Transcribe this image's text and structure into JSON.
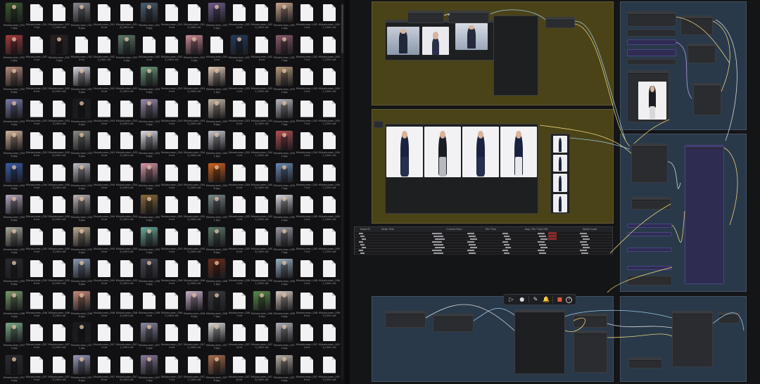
{
  "file_browser": {
    "columns": 15,
    "rows": 12,
    "files": [
      {
        "kind": "img",
        "name": "Miniakumen_0017.jpg",
        "color": "#3b5a2e"
      },
      {
        "kind": "doc",
        "name": "Miniakumen_0017.txt"
      },
      {
        "kind": "doc",
        "name": "Miniakumen_0017_0001.txt"
      },
      {
        "kind": "img",
        "name": "Miniakumen_0018.jpg",
        "color": "#8a8890"
      },
      {
        "kind": "doc",
        "name": "Miniakumen_0018.txt"
      },
      {
        "kind": "doc",
        "name": "Miniakumen_0018_0001.txt"
      },
      {
        "kind": "img",
        "name": "Miniakumen_0019.jpg",
        "color": "#4a5d6e"
      },
      {
        "kind": "doc",
        "name": "Miniakumen_0019.txt"
      },
      {
        "kind": "doc",
        "name": "Miniakumen_0019_0001.txt"
      },
      {
        "kind": "img",
        "name": "Miniakumen_0020.jpg",
        "color": "#6e5b8a"
      },
      {
        "kind": "doc",
        "name": "Miniakumen_0020.txt"
      },
      {
        "kind": "doc",
        "name": "Miniakumen_0020_0001.txt"
      },
      {
        "kind": "img",
        "name": "Miniakumen_0021.jpg",
        "color": "#c5a58c"
      },
      {
        "kind": "doc",
        "name": "Miniakumen_0021.txt"
      },
      {
        "kind": "doc",
        "name": "Miniakumen_0021_0001.txt"
      },
      {
        "kind": "img",
        "name": "Miniakumen_0022.jpg",
        "color": "#a33a3a"
      },
      {
        "kind": "doc",
        "name": "Miniakumen_0022.txt"
      },
      {
        "kind": "img",
        "name": "Miniakumen_0023.jpg",
        "color": "#2a1f1f"
      },
      {
        "kind": "doc",
        "name": "Miniakumen_0023.txt"
      },
      {
        "kind": "doc",
        "name": "Miniakumen_0023_0001.txt"
      },
      {
        "kind": "img",
        "name": "Miniakumen_0024.jpg",
        "color": "#5b7a6a"
      },
      {
        "kind": "doc",
        "name": "Miniakumen_0024.txt"
      },
      {
        "kind": "doc",
        "name": "Miniakumen_0024_0001.txt"
      },
      {
        "kind": "img",
        "name": "Miniakumen_0025.jpg",
        "color": "#c98a93"
      },
      {
        "kind": "doc",
        "name": "Miniakumen_0025.txt"
      },
      {
        "kind": "img",
        "name": "Miniakumen_0026.jpg",
        "color": "#243a5a"
      },
      {
        "kind": "doc",
        "name": "Miniakumen_0026.txt"
      },
      {
        "kind": "img",
        "name": "Miniakumen_0027.jpg",
        "color": "#8a5a6a"
      },
      {
        "kind": "doc",
        "name": "Miniakumen_0027.txt"
      },
      {
        "kind": "doc",
        "name": "Miniakumen_0027_0001.txt"
      },
      {
        "kind": "img",
        "name": "Miniakumen_0028.jpg",
        "color": "#b58a7a"
      },
      {
        "kind": "doc",
        "name": "Miniakumen_0028.txt"
      },
      {
        "kind": "doc",
        "name": "Miniakumen_0028_0001.txt"
      },
      {
        "kind": "img",
        "name": "Miniakumen_0029.jpg",
        "color": "#d8d4dc"
      },
      {
        "kind": "doc",
        "name": "Miniakumen_0029.txt"
      },
      {
        "kind": "doc",
        "name": "Miniakumen_0029_0001.txt"
      },
      {
        "kind": "img",
        "name": "Miniakumen_0030.jpg",
        "color": "#6a9a7a"
      },
      {
        "kind": "doc",
        "name": "Miniakumen_0030.txt"
      },
      {
        "kind": "doc",
        "name": "Miniakumen_0030_0001.txt"
      },
      {
        "kind": "img",
        "name": "Miniakumen_0031.jpg",
        "color": "#e2c9b8"
      },
      {
        "kind": "doc",
        "name": "Miniakumen_0031.txt"
      },
      {
        "kind": "doc",
        "name": "Miniakumen_0031_0001.txt"
      },
      {
        "kind": "img",
        "name": "Miniakumen_0032.jpg",
        "color": "#b59a7a"
      },
      {
        "kind": "doc",
        "name": "Miniakumen_0032.txt"
      },
      {
        "kind": "doc",
        "name": "Miniakumen_0032_0001.txt"
      },
      {
        "kind": "img",
        "name": "Miniakumen_0033.jpg",
        "color": "#7a7aa8"
      },
      {
        "kind": "doc",
        "name": "Miniakumen_0033.txt"
      },
      {
        "kind": "doc",
        "name": "Miniakumen_0033_0001.txt"
      },
      {
        "kind": "img",
        "name": "Miniakumen_0034.jpg",
        "color": "#1a1a1a"
      },
      {
        "kind": "doc",
        "name": "Miniakumen_0034.txt"
      },
      {
        "kind": "doc",
        "name": "Miniakumen_0034_0001.txt"
      },
      {
        "kind": "img",
        "name": "Miniakumen_0035.jpg",
        "color": "#9a8aa8"
      },
      {
        "kind": "doc",
        "name": "Miniakumen_0035.txt"
      },
      {
        "kind": "doc",
        "name": "Miniakumen_0035_0001.txt"
      },
      {
        "kind": "img",
        "name": "Miniakumen_0036.jpg",
        "color": "#c8b8a8"
      },
      {
        "kind": "doc",
        "name": "Miniakumen_0036.txt"
      },
      {
        "kind": "doc",
        "name": "Miniakumen_0036_0001.txt"
      },
      {
        "kind": "img",
        "name": "Miniakumen_0037.jpg",
        "color": "#b8b8c0"
      },
      {
        "kind": "doc",
        "name": "Miniakumen_0037.txt"
      },
      {
        "kind": "doc",
        "name": "Miniakumen_0037_0001.txt"
      },
      {
        "kind": "img",
        "name": "Miniakumen_0038.jpg",
        "color": "#d2b49a"
      },
      {
        "kind": "doc",
        "name": "Miniakumen_0038.txt"
      },
      {
        "kind": "doc",
        "name": "Miniakumen_0038_0001.txt"
      },
      {
        "kind": "img",
        "name": "Miniakumen_0039.jpg",
        "color": "#8a8a82"
      },
      {
        "kind": "doc",
        "name": "Miniakumen_0039.txt"
      },
      {
        "kind": "doc",
        "name": "Miniakumen_0039_0001.txt"
      },
      {
        "kind": "img",
        "name": "Miniakumen_0040.jpg",
        "color": "#e0dde6"
      },
      {
        "kind": "doc",
        "name": "Miniakumen_0040.txt"
      },
      {
        "kind": "doc",
        "name": "Miniakumen_0040_0001.txt"
      },
      {
        "kind": "img",
        "name": "Miniakumen_0041.jpg",
        "color": "#c8c8d2"
      },
      {
        "kind": "doc",
        "name": "Miniakumen_0041.txt"
      },
      {
        "kind": "doc",
        "name": "Miniakumen_0041_0001.txt"
      },
      {
        "kind": "img",
        "name": "Miniakumen_0042.jpg",
        "color": "#b05050"
      },
      {
        "kind": "doc",
        "name": "Miniakumen_0042.txt"
      },
      {
        "kind": "doc",
        "name": "Miniakumen_0042_0001.txt"
      },
      {
        "kind": "img",
        "name": "Miniakumen_0043.jpg",
        "color": "#3a5aa8"
      },
      {
        "kind": "doc",
        "name": "Miniakumen_0043.txt"
      },
      {
        "kind": "doc",
        "name": "Miniakumen_0043_0001.txt"
      },
      {
        "kind": "img",
        "name": "Miniakumen_0044.jpg",
        "color": "#c0bcc6"
      },
      {
        "kind": "doc",
        "name": "Miniakumen_0044.txt"
      },
      {
        "kind": "doc",
        "name": "Miniakumen_0044_0001.txt"
      },
      {
        "kind": "img",
        "name": "Miniakumen_0045.jpg",
        "color": "#d898a8"
      },
      {
        "kind": "doc",
        "name": "Miniakumen_0045.txt"
      },
      {
        "kind": "doc",
        "name": "Miniakumen_0045_0001.txt"
      },
      {
        "kind": "img",
        "name": "Miniakumen_0046.jpg",
        "color": "#d0601a"
      },
      {
        "kind": "doc",
        "name": "Miniakumen_0046.txt"
      },
      {
        "kind": "doc",
        "name": "Miniakumen_0046_0001.txt"
      },
      {
        "kind": "img",
        "name": "Miniakumen_0047.jpg",
        "color": "#6a8ab0"
      },
      {
        "kind": "doc",
        "name": "Miniakumen_0047.txt"
      },
      {
        "kind": "doc",
        "name": "Miniakumen_0047_0001.txt"
      },
      {
        "kind": "img",
        "name": "Miniakumen_0048.jpg",
        "color": "#b4a8c0"
      },
      {
        "kind": "doc",
        "name": "Miniakumen_0048.txt"
      },
      {
        "kind": "doc",
        "name": "Miniakumen_0048_0001.txt"
      },
      {
        "kind": "img",
        "name": "Miniakumen_0049.jpg",
        "color": "#c0b4b4"
      },
      {
        "kind": "doc",
        "name": "Miniakumen_0049.txt"
      },
      {
        "kind": "doc",
        "name": "Miniakumen_0049_0001.txt"
      },
      {
        "kind": "img",
        "name": "Miniakumen_0050.jpg",
        "color": "#8a6a3a"
      },
      {
        "kind": "doc",
        "name": "Miniakumen_0050.txt"
      },
      {
        "kind": "doc",
        "name": "Miniakumen_0050_0001.txt"
      },
      {
        "kind": "img",
        "name": "Miniakumen_0051.jpg",
        "color": "#7a8a8a"
      },
      {
        "kind": "doc",
        "name": "Miniakumen_0051.txt"
      },
      {
        "kind": "doc",
        "name": "Miniakumen_0051_0001.txt"
      },
      {
        "kind": "img",
        "name": "Miniakumen_0052.jpg",
        "color": "#d8d8e0"
      },
      {
        "kind": "doc",
        "name": "Miniakumen_0052.txt"
      },
      {
        "kind": "doc",
        "name": "Miniakumen_0052_0001.txt"
      },
      {
        "kind": "img",
        "name": "Miniakumen_0053.jpg",
        "color": "#a8a89a"
      },
      {
        "kind": "doc",
        "name": "Miniakumen_0053.txt"
      },
      {
        "kind": "doc",
        "name": "Miniakumen_0053_0001.txt"
      },
      {
        "kind": "img",
        "name": "Miniakumen_0054.jpg",
        "color": "#b8a890"
      },
      {
        "kind": "doc",
        "name": "Miniakumen_0054.txt"
      },
      {
        "kind": "doc",
        "name": "Miniakumen_0054_0001.txt"
      },
      {
        "kind": "img",
        "name": "Miniakumen_0055.jpg",
        "color": "#6aa89a"
      },
      {
        "kind": "doc",
        "name": "Miniakumen_0055.txt"
      },
      {
        "kind": "doc",
        "name": "Miniakumen_0055_0001.txt"
      },
      {
        "kind": "img",
        "name": "Miniakumen_0056.jpg",
        "color": "#5a7a6a"
      },
      {
        "kind": "doc",
        "name": "Miniakumen_0056.txt"
      },
      {
        "kind": "doc",
        "name": "Miniakumen_0056_0001.txt"
      },
      {
        "kind": "img",
        "name": "Miniakumen_0057.jpg",
        "color": "#9a9aa4"
      },
      {
        "kind": "doc",
        "name": "Miniakumen_0057.txt"
      },
      {
        "kind": "doc",
        "name": "Miniakumen_0057_0001.txt"
      },
      {
        "kind": "img",
        "name": "Miniakumen_0058.jpg",
        "color": "#2a2a2e"
      },
      {
        "kind": "doc",
        "name": "Miniakumen_0058.txt"
      },
      {
        "kind": "doc",
        "name": "Miniakumen_0058_0001.txt"
      },
      {
        "kind": "img",
        "name": "Miniakumen_0059.jpg",
        "color": "#8a9ab0"
      },
      {
        "kind": "doc",
        "name": "Miniakumen_0059.txt"
      },
      {
        "kind": "doc",
        "name": "Miniakumen_0059_0001.txt"
      },
      {
        "kind": "img",
        "name": "Miniakumen_0060.jpg",
        "color": "#4a4a58"
      },
      {
        "kind": "doc",
        "name": "Miniakumen_0060.txt"
      },
      {
        "kind": "doc",
        "name": "Miniakumen_0060_0001.txt"
      },
      {
        "kind": "img",
        "name": "Miniakumen_0061.jpg",
        "color": "#6a2a1a"
      },
      {
        "kind": "doc",
        "name": "Miniakumen_0061.txt"
      },
      {
        "kind": "doc",
        "name": "Miniakumen_0061_0001.txt"
      },
      {
        "kind": "img",
        "name": "Miniakumen_0062.jpg",
        "color": "#9ab0c0"
      },
      {
        "kind": "doc",
        "name": "Miniakumen_0062.txt"
      },
      {
        "kind": "doc",
        "name": "Miniakumen_0062_0001.txt"
      },
      {
        "kind": "img",
        "name": "Miniakumen_0063.jpg",
        "color": "#7a9a6a"
      },
      {
        "kind": "doc",
        "name": "Miniakumen_0063.txt"
      },
      {
        "kind": "doc",
        "name": "Miniakumen_0063_0001.txt"
      },
      {
        "kind": "img",
        "name": "Miniakumen_0064.jpg",
        "color": "#c88a7a"
      },
      {
        "kind": "doc",
        "name": "Miniakumen_0064.txt"
      },
      {
        "kind": "doc",
        "name": "Miniakumen_0064_0001.txt"
      },
      {
        "kind": "doc",
        "name": "Miniakumen_0065.txt"
      },
      {
        "kind": "doc",
        "name": "Miniakumen_0065_0001.txt"
      },
      {
        "kind": "img",
        "name": "Miniakumen_0066.jpg",
        "color": "#c8b0c8"
      },
      {
        "kind": "img",
        "name": "Miniakumen_0067.jpg",
        "color": "#3a3a3e"
      },
      {
        "kind": "doc",
        "name": "Miniakumen_0067.txt"
      },
      {
        "kind": "img",
        "name": "Miniakumen_0068.jpg",
        "color": "#5a8a4a"
      },
      {
        "kind": "img",
        "name": "Miniakumen_0069.jpg",
        "color": "#d8c8c0"
      },
      {
        "kind": "doc",
        "name": "Miniakumen_0069.txt"
      },
      {
        "kind": "doc",
        "name": "Miniakumen_0069_0001.txt"
      },
      {
        "kind": "img",
        "name": "Miniakumen_0070.jpg",
        "color": "#7aaa8a"
      },
      {
        "kind": "doc",
        "name": "Miniakumen_0070.txt"
      },
      {
        "kind": "doc",
        "name": "Miniakumen_0070_0001.txt"
      },
      {
        "kind": "img",
        "name": "Miniakumen_0071.jpg",
        "color": "#1a1a1e"
      },
      {
        "kind": "doc",
        "name": "Miniakumen_0071.txt"
      },
      {
        "kind": "doc",
        "name": "Miniakumen_0071_0001.txt"
      },
      {
        "kind": "img",
        "name": "Miniakumen_0072.jpg",
        "color": "#8a8aa0"
      },
      {
        "kind": "doc",
        "name": "Miniakumen_0072.txt"
      },
      {
        "kind": "doc",
        "name": "Miniakumen_0072_0001.txt"
      },
      {
        "kind": "img",
        "name": "Miniakumen_0073.jpg",
        "color": "#d8d8d8"
      },
      {
        "kind": "doc",
        "name": "Miniakumen_0073.txt"
      },
      {
        "kind": "doc",
        "name": "Miniakumen_0073_0001.txt"
      },
      {
        "kind": "img",
        "name": "Miniakumen_0074.jpg",
        "color": "#b0b0b8"
      },
      {
        "kind": "doc",
        "name": "Miniakumen_0074.txt"
      },
      {
        "kind": "doc",
        "name": "Miniakumen_0074_0001.txt"
      },
      {
        "kind": "img",
        "name": "Miniakumen_0075.jpg",
        "color": "#2a2a30"
      },
      {
        "kind": "doc",
        "name": "Miniakumen_0075.txt"
      },
      {
        "kind": "doc",
        "name": "Miniakumen_0075_0001.txt"
      },
      {
        "kind": "img",
        "name": "Miniakumen_0076.jpg",
        "color": "#9a9ab8"
      },
      {
        "kind": "doc",
        "name": "Miniakumen_0076.txt"
      },
      {
        "kind": "doc",
        "name": "Miniakumen_0076_0001.txt"
      },
      {
        "kind": "img",
        "name": "Miniakumen_0077.jpg",
        "color": "#8a7a9a"
      },
      {
        "kind": "doc",
        "name": "Miniakumen_0077.txt"
      },
      {
        "kind": "doc",
        "name": "Miniakumen_0077_0001.txt"
      },
      {
        "kind": "img",
        "name": "Miniakumen_0078.jpg",
        "color": "#a86a4a"
      },
      {
        "kind": "doc",
        "name": "Miniakumen_0078.txt"
      },
      {
        "kind": "doc",
        "name": "Miniakumen_0078_0001.txt"
      },
      {
        "kind": "img",
        "name": "Miniakumen_0079.jpg",
        "color": "#b8b0a8"
      },
      {
        "kind": "doc",
        "name": "Miniakumen_0079.txt"
      },
      {
        "kind": "doc",
        "name": "Miniakumen_0079_0001.txt"
      }
    ]
  },
  "node_editor": {
    "theme": {
      "olive_group": "#4a4318",
      "blue_group": "#29394a",
      "wire_colors": [
        "#e8d27a",
        "#9ac8e0",
        "#d8d8d8",
        "#b8a0e0"
      ]
    },
    "table": {
      "headers": [
        "Node ID",
        "Node Title",
        "Current Exec",
        "Per Time",
        "Avg / Per Time Diff",
        "Model Load"
      ]
    },
    "toolbar": {
      "buttons": [
        {
          "name": "run-button",
          "icon": "play-icon",
          "glyph": "▷"
        },
        {
          "name": "queue-button",
          "icon": "queue-icon",
          "glyph": "●"
        },
        {
          "name": "edit-button",
          "icon": "pencil-icon",
          "glyph": "✎"
        },
        {
          "name": "bell-button",
          "icon": "bell-icon",
          "glyph": "🔔"
        },
        {
          "name": "stop-button",
          "icon": "stop-icon",
          "glyph": "■"
        },
        {
          "name": "help-button",
          "icon": "help-icon",
          "glyph": "?"
        }
      ]
    }
  }
}
